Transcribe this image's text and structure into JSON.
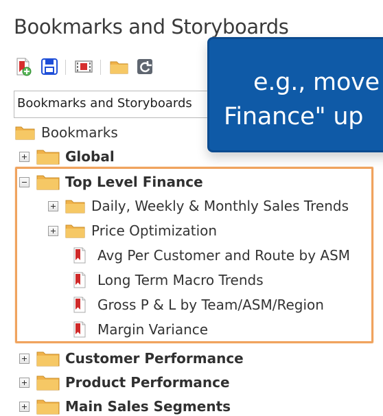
{
  "panel": {
    "title": "Bookmarks and Storyboards"
  },
  "toolbar": {
    "buttons": [
      {
        "name": "new-bookmark",
        "icon": "new-bookmark-icon"
      },
      {
        "name": "save",
        "icon": "save-icon"
      },
      {
        "name": "storyboard",
        "icon": "storyboard-icon"
      },
      {
        "name": "open-folder",
        "icon": "folder-icon"
      },
      {
        "name": "refresh",
        "icon": "refresh-icon"
      }
    ]
  },
  "selector": {
    "value": "Bookmarks and Storyboards"
  },
  "tree": {
    "root": "Bookmarks",
    "global": "Global",
    "top_level_finance": "Top Level Finance",
    "daily_weekly_monthly": "Daily, Weekly & Monthly Sales Trends",
    "price_optimization": "Price Optimization",
    "avg_per_customer": "Avg Per Customer and Route by ASM",
    "long_term_macro": "Long Term Macro Trends",
    "gross_pl": "Gross P & L by Team/ASM/Region",
    "margin_variance": "Margin Variance",
    "customer_performance": "Customer Performance",
    "product_performance": "Product Performance",
    "main_sales_segments": "Main Sales Segments"
  },
  "callout": {
    "line1": "e.g., move \"Top Level",
    "line2": "Finance\" up"
  },
  "colors": {
    "callout_bg": "#0f5aa7",
    "highlight": "#f0a35e",
    "folder": "#f0b24a",
    "bookmark_red": "#cf2a2a"
  }
}
